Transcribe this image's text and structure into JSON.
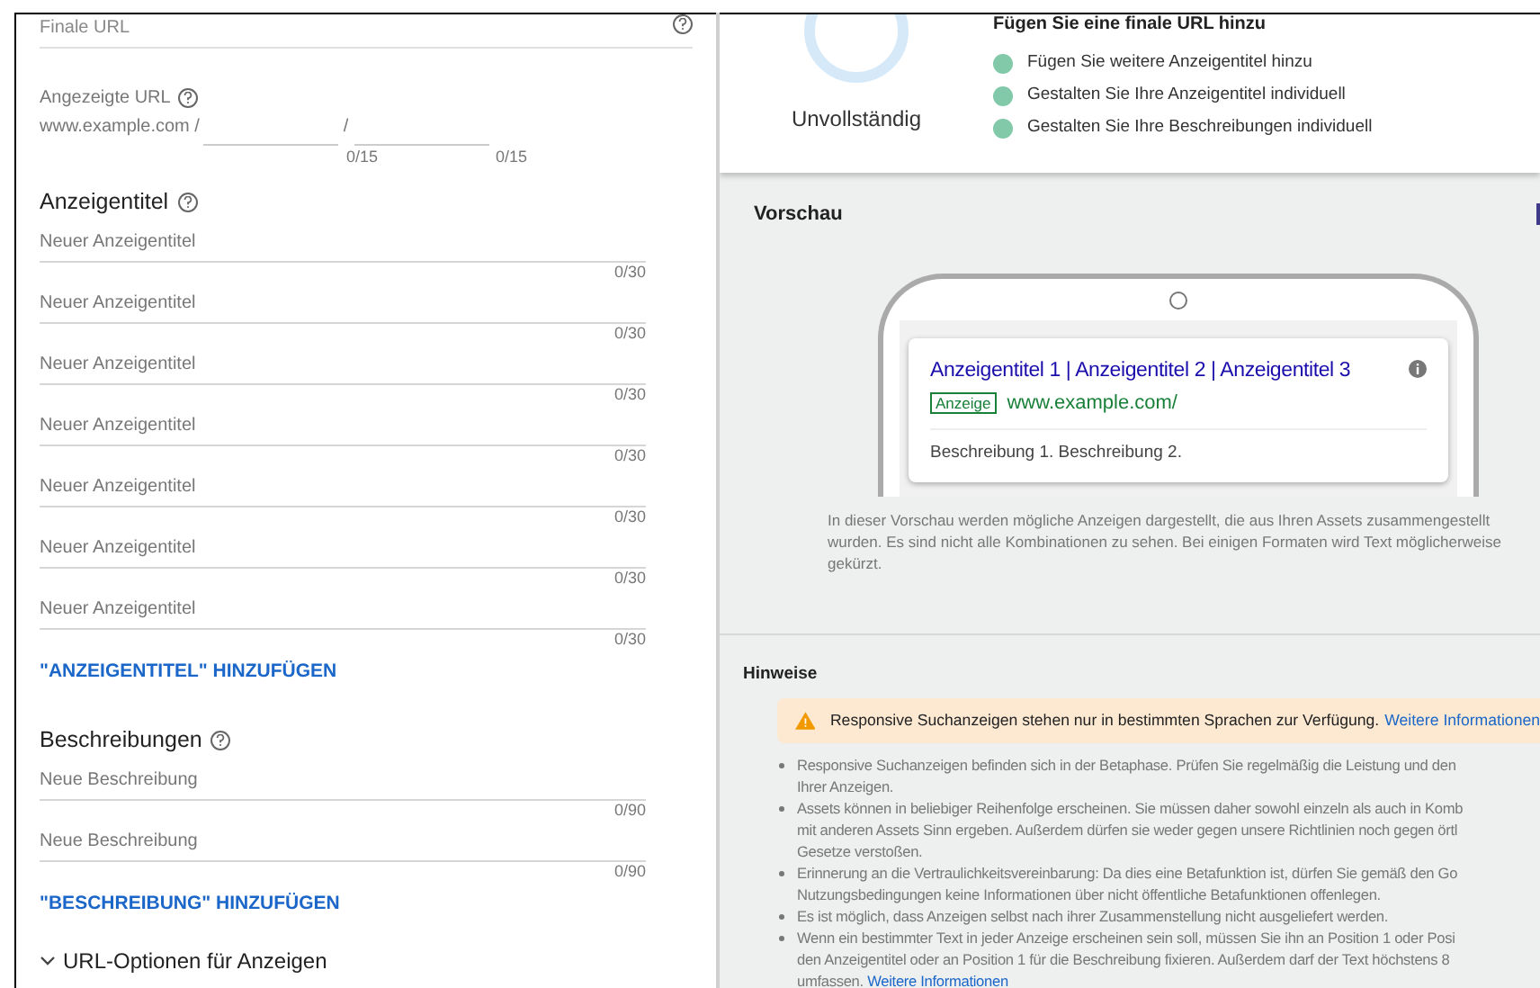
{
  "final_url": {
    "placeholder": "Finale URL"
  },
  "display_url": {
    "label": "Angezeigte URL",
    "domain": "www.example.com /",
    "separator": "/",
    "path_counters": [
      "0/15",
      "0/15"
    ]
  },
  "headlines": {
    "title": "Anzeigentitel",
    "fields": [
      {
        "placeholder": "Neuer Anzeigentitel",
        "counter": "0/30"
      },
      {
        "placeholder": "Neuer Anzeigentitel",
        "counter": "0/30"
      },
      {
        "placeholder": "Neuer Anzeigentitel",
        "counter": "0/30"
      },
      {
        "placeholder": "Neuer Anzeigentitel",
        "counter": "0/30"
      },
      {
        "placeholder": "Neuer Anzeigentitel",
        "counter": "0/30"
      },
      {
        "placeholder": "Neuer Anzeigentitel",
        "counter": "0/30"
      },
      {
        "placeholder": "Neuer Anzeigentitel",
        "counter": "0/30"
      }
    ],
    "add_button": "\"ANZEIGENTITEL\" HINZUFÜGEN"
  },
  "descriptions": {
    "title": "Beschreibungen",
    "fields": [
      {
        "placeholder": "Neue Beschreibung",
        "counter": "0/90"
      },
      {
        "placeholder": "Neue Beschreibung",
        "counter": "0/90"
      }
    ],
    "add_button": "\"BESCHREIBUNG\" HINZUFÜGEN"
  },
  "url_options": {
    "label": "URL-Optionen für Anzeigen"
  },
  "ad_strength": {
    "rating": "Unvollständig",
    "heading": "Fügen Sie eine finale URL hinzu",
    "tips": [
      "Fügen Sie weitere Anzeigentitel hinzu",
      "Gestalten Sie Ihre Anzeigentitel individuell",
      "Gestalten Sie Ihre Beschreibungen individuell"
    ]
  },
  "preview": {
    "title": "Vorschau",
    "ad": {
      "headline": "Anzeigentitel 1 | Anzeigentitel 2 | Anzeigentitel 3",
      "badge": "Anzeige",
      "url": "www.example.com/",
      "description": "Beschreibung 1. Beschreibung 2."
    },
    "caption": "In dieser Vorschau werden mögliche Anzeigen dargestellt, die aus Ihren Assets zusammengestellt wurden. Es sind nicht alle Kombinationen zu sehen. Bei einigen Formaten wird Text möglicherweise gekürzt."
  },
  "notes": {
    "title": "Hinweise",
    "warning": {
      "text": "Responsive Suchanzeigen stehen nur in bestimmten Sprachen zur Verfügung.",
      "link": "Weitere Informationen"
    },
    "bullets": [
      {
        "lines": [
          "Responsive Suchanzeigen befinden sich in der Betaphase. Prüfen Sie regelmäßig die Leistung und den",
          "Ihrer Anzeigen."
        ]
      },
      {
        "lines": [
          "Assets können in beliebiger Reihenfolge erscheinen. Sie müssen daher sowohl einzeln als auch in Komb",
          "mit anderen Assets Sinn ergeben. Außerdem dürfen sie weder gegen unsere Richtlinien noch gegen örtl",
          "Gesetze verstoßen."
        ]
      },
      {
        "lines": [
          "Erinnerung an die Vertraulichkeitsvereinbarung: Da dies eine Betafunktion ist, dürfen Sie gemäß den Go",
          "Nutzungsbedingungen keine Informationen über nicht öffentliche Betafunktionen offenlegen."
        ]
      },
      {
        "lines": [
          "Es ist möglich, dass Anzeigen selbst nach ihrer Zusammenstellung nicht ausgeliefert werden."
        ]
      },
      {
        "lines": [
          "Wenn ein bestimmter Text in jeder Anzeige erscheinen sein soll, müssen Sie ihn an Position 1 oder Posi",
          "den Anzeigentitel oder an Position 1 für die Beschreibung fixieren. Außerdem darf der Text höchstens 8",
          "umfassen."
        ],
        "link": "Weitere Informationen"
      }
    ]
  }
}
